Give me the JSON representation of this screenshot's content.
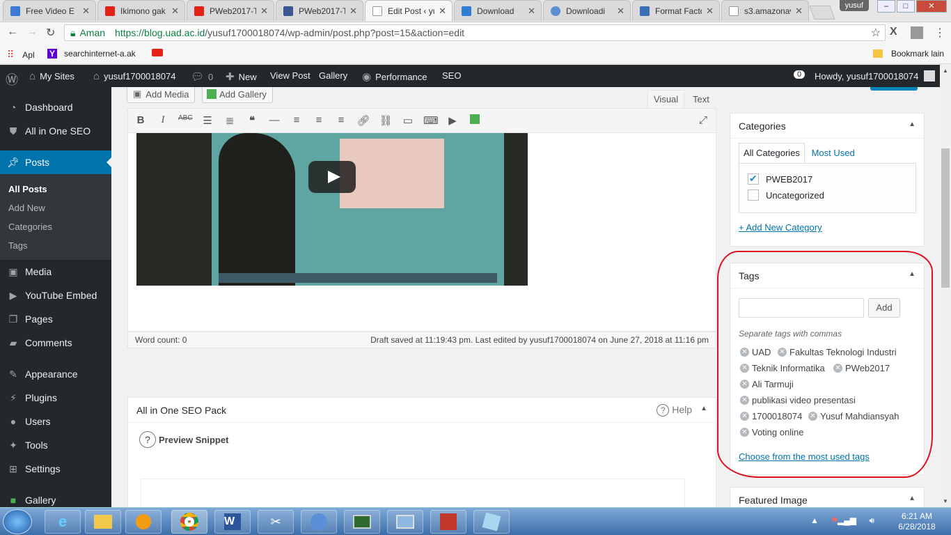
{
  "browser": {
    "tabs": [
      {
        "title": "Free Video E",
        "color": "#3a7bd5"
      },
      {
        "title": "Ikimono gak",
        "color": "#e62117"
      },
      {
        "title": "PWeb2017-T",
        "color": "#e62117"
      },
      {
        "title": "PWeb2017-T",
        "color": "#3a5795"
      },
      {
        "title": "Edit Post ‹ yu",
        "color": "#ffffff"
      },
      {
        "title": "Download",
        "color": "#2f7bd6"
      },
      {
        "title": "Downloadi",
        "color": "#5a8fd0"
      },
      {
        "title": "Format Facto",
        "color": "#3b6fb5"
      },
      {
        "title": "s3.amazonav",
        "color": "#ffffff"
      }
    ],
    "user_badge": "yusuf",
    "secure_label": "Aman",
    "url_host": "https://blog.uad.ac.id",
    "url_path": "/yusuf1700018074/wp-admin/post.php?post=15&action=edit",
    "bookmarks": {
      "apps": "Apl",
      "search": "searchinternet-a.ak",
      "other": "Bookmark lain"
    }
  },
  "adminbar": {
    "my_sites": "My Sites",
    "site": "yusuf1700018074",
    "comments": "0",
    "new": "New",
    "view_post": "View Post",
    "gallery": "Gallery",
    "performance": "Performance",
    "seo": "SEO",
    "notif": "0",
    "howdy": "Howdy, yusuf1700018074"
  },
  "sidebar": {
    "dashboard": "Dashboard",
    "aioseo": "All in One SEO",
    "posts": "Posts",
    "sub": [
      "All Posts",
      "Add New",
      "Categories",
      "Tags"
    ],
    "media": "Media",
    "youtube": "YouTube Embed",
    "pages": "Pages",
    "comments": "Comments",
    "appearance": "Appearance",
    "plugins": "Plugins",
    "users": "Users",
    "tools": "Tools",
    "settings": "Settings",
    "gallery": "Gallery"
  },
  "editor": {
    "add_media": "Add Media",
    "add_gallery": "Add Gallery",
    "tab_visual": "Visual",
    "tab_text": "Text",
    "word_count": "Word count: 0",
    "draft_status": "Draft saved at 11:19:43 pm. Last edited by yusuf1700018074 on June 27, 2018 at 11:16 pm"
  },
  "seo_box": {
    "title": "All in One SEO Pack",
    "help": "Help",
    "preview": "Preview Snippet"
  },
  "categories": {
    "title": "Categories",
    "tab_all": "All Categories",
    "tab_most": "Most Used",
    "items": [
      {
        "label": "PWEB2017",
        "checked": true
      },
      {
        "label": "Uncategorized",
        "checked": false
      }
    ],
    "add_new": "+ Add New Category"
  },
  "tags": {
    "title": "Tags",
    "add_button": "Add",
    "hint": "Separate tags with commas",
    "items": [
      "UAD",
      "Fakultas Teknologi Industri",
      "Teknik Informatika",
      "PWeb2017",
      "Ali Tarmuji",
      "publikasi video presentasi",
      "1700018074",
      "Yusuf Mahdiansyah",
      "Voting online"
    ],
    "choose_link": "Choose from the most used tags"
  },
  "featured": {
    "title": "Featured Image"
  },
  "taskbar": {
    "time": "6:21 AM",
    "date": "6/28/2018"
  },
  "colors": {
    "wp_blue": "#0073aa",
    "admin_dark": "#23282d",
    "annotation_red": "#e01020"
  }
}
